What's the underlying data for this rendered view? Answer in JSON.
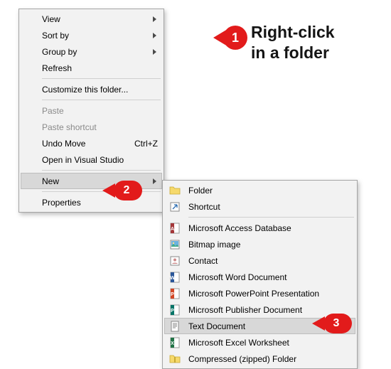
{
  "instruction": {
    "line1": "Right-click",
    "line2": "in a folder"
  },
  "badges": {
    "b1": "1",
    "b2": "2",
    "b3": "3"
  },
  "menu1": {
    "view": "View",
    "sortby": "Sort by",
    "groupby": "Group by",
    "refresh": "Refresh",
    "customize": "Customize this folder...",
    "paste": "Paste",
    "paste_shortcut": "Paste shortcut",
    "undo_move": "Undo Move",
    "undo_shortcut": "Ctrl+Z",
    "open_vs": "Open in Visual Studio",
    "new": "New",
    "properties": "Properties"
  },
  "menu2": {
    "folder": "Folder",
    "shortcut": "Shortcut",
    "access": "Microsoft Access Database",
    "bitmap": "Bitmap image",
    "contact": "Contact",
    "word": "Microsoft Word Document",
    "ppt": "Microsoft PowerPoint Presentation",
    "pub": "Microsoft Publisher Document",
    "text": "Text Document",
    "excel": "Microsoft Excel Worksheet",
    "zip": "Compressed (zipped) Folder"
  }
}
